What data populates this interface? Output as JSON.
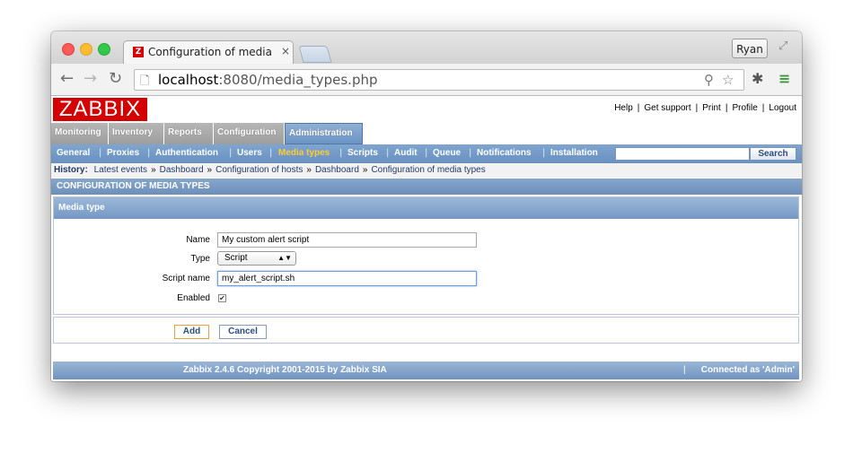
{
  "browser": {
    "tab_title": "Configuration of media typ",
    "tab_favicon": "Z",
    "tab_close": "×",
    "user_button": "Ryan",
    "url_host": "localhost",
    "url_rest": ":8080/media_types.php"
  },
  "zabbix": {
    "logo": "ZABBIX",
    "top_links": [
      "Help",
      "Get support",
      "Print",
      "Profile",
      "Logout"
    ],
    "main_menu": [
      {
        "label": "Monitoring",
        "selected": false
      },
      {
        "label": "Inventory",
        "selected": false
      },
      {
        "label": "Reports",
        "selected": false
      },
      {
        "label": "Configuration",
        "selected": false
      },
      {
        "label": "Administration",
        "selected": true
      }
    ],
    "sub_menu": [
      {
        "label": "General",
        "selected": false
      },
      {
        "label": "Proxies",
        "selected": false
      },
      {
        "label": "Authentication",
        "selected": false
      },
      {
        "label": "Users",
        "selected": false
      },
      {
        "label": "Media types",
        "selected": true
      },
      {
        "label": "Scripts",
        "selected": false
      },
      {
        "label": "Audit",
        "selected": false
      },
      {
        "label": "Queue",
        "selected": false
      },
      {
        "label": "Notifications",
        "selected": false
      },
      {
        "label": "Installation",
        "selected": false
      }
    ],
    "search_button": "Search",
    "history_label": "History:",
    "history": [
      "Latest events",
      "Dashboard",
      "Configuration of hosts",
      "Dashboard",
      "Configuration of media types"
    ],
    "history_sep": "»",
    "section_title": "CONFIGURATION OF MEDIA TYPES",
    "form": {
      "header": "Media type",
      "name_label": "Name",
      "name_value": "My custom alert script",
      "type_label": "Type",
      "type_value": "Script",
      "script_label": "Script name",
      "script_value": "my_alert_script.sh",
      "enabled_label": "Enabled",
      "enabled": true
    },
    "add_button": "Add",
    "cancel_button": "Cancel",
    "footer_copyright": "Zabbix 2.4.6 Copyright 2001-2015 by Zabbix SIA",
    "footer_sep": "|",
    "footer_connected": "Connected as 'Admin'"
  },
  "colors": {
    "logo_red": "#d40000",
    "menu_blue": "#6a91bf",
    "selected_sub": "#ffcc33"
  }
}
